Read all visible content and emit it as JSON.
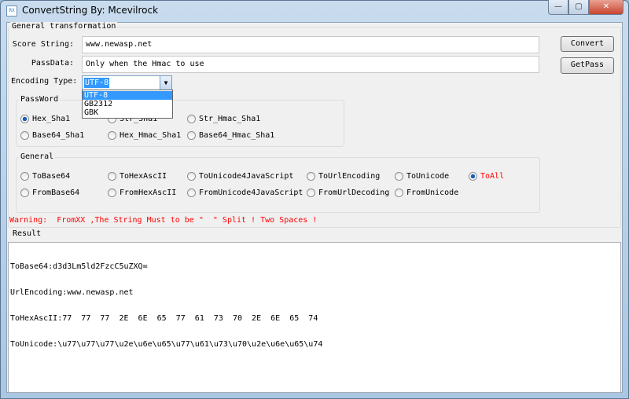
{
  "window": {
    "title": "ConvertString By: Mcevilrock",
    "icon_text": "RX",
    "minimize": "—",
    "maximize": "▢",
    "close": "✕"
  },
  "general_group": {
    "label": "General transformation"
  },
  "score_string": {
    "label": "Score String:",
    "value": "www.newasp.net"
  },
  "pass_data": {
    "label": "PassData:",
    "value": "Only when the Hmac to use"
  },
  "encoding": {
    "label": "Encoding Type:",
    "value": "UTF-8",
    "options": [
      "UTF-8",
      "GB2312",
      "GBK"
    ]
  },
  "buttons": {
    "convert": "Convert",
    "getpass": "GetPass"
  },
  "password_group": {
    "label": "PassWord",
    "options": [
      "Hex_Sha1",
      "Str_Sha1",
      "Str_Hmac_Sha1",
      "Base64_Sha1",
      "Hex_Hmac_Sha1",
      "Base64_Hmac_Sha1"
    ],
    "selected": "Hex_Sha1"
  },
  "general": {
    "label": "General",
    "options": [
      "ToBase64",
      "ToHexAscII",
      "ToUnicode4JavaScript",
      "ToUrlEncoding",
      "ToUnicode",
      "ToAll",
      "FromBase64",
      "FromHexAscII",
      "FromUnicode4JavaScript",
      "FromUrlDecoding",
      "FromUnicode"
    ],
    "selected": "ToAll",
    "selected_color": "#ff0000"
  },
  "warning": {
    "text": "Warning:  FromXX ,The String Must to be \"  \" Split ! Two Spaces !",
    "color": "#ff0000"
  },
  "result": {
    "label": "Result",
    "lines": [
      "ToBase64:d3d3Lm5ld2FzcC5uZXQ=",
      "UrlEncoding:www.newasp.net",
      "ToHexAscII:77  77  77  2E  6E  65  77  61  73  70  2E  6E  65  74",
      "ToUnicode:\\u77\\u77\\u77\\u2e\\u6e\\u65\\u77\\u61\\u73\\u70\\u2e\\u6e\\u65\\u74"
    ]
  }
}
